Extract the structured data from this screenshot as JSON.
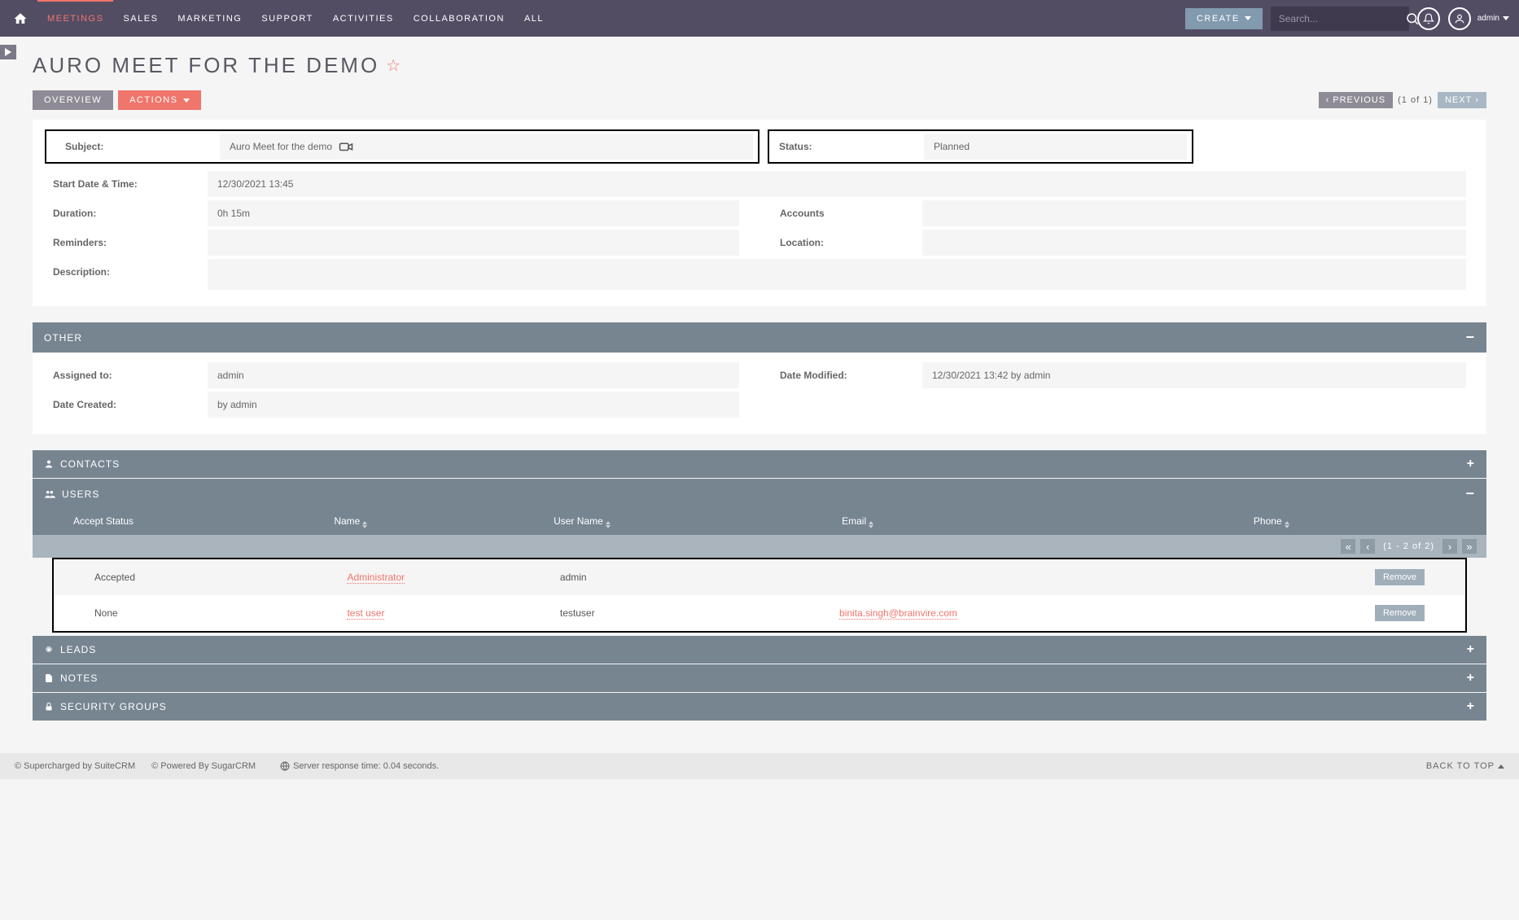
{
  "nav": {
    "items": [
      "MEETINGS",
      "SALES",
      "MARKETING",
      "SUPPORT",
      "ACTIVITIES",
      "COLLABORATION",
      "ALL"
    ],
    "create_label": "CREATE",
    "search_placeholder": "Search...",
    "admin_label": "admin"
  },
  "page": {
    "title": "AURO MEET FOR THE DEMO",
    "overview_btn": "OVERVIEW",
    "actions_btn": "ACTIONS",
    "prev_btn": "PREVIOUS",
    "count_text": "(1 of 1)",
    "next_btn": "NEXT"
  },
  "details": {
    "subject_label": "Subject:",
    "subject_value": "Auro Meet for the demo",
    "status_label": "Status:",
    "status_value": "Planned",
    "start_label": "Start Date & Time:",
    "start_value": "12/30/2021 13:45",
    "duration_label": "Duration:",
    "duration_value": "0h 15m",
    "accounts_label": "Accounts",
    "reminders_label": "Reminders:",
    "location_label": "Location:",
    "description_label": "Description:"
  },
  "other": {
    "header": "OTHER",
    "assigned_label": "Assigned to:",
    "assigned_value": "admin",
    "modified_label": "Date Modified:",
    "modified_value": "12/30/2021 13:42 by admin",
    "created_label": "Date Created:",
    "created_value": "by admin"
  },
  "panels": {
    "contacts": "CONTACTS",
    "users": "USERS",
    "leads": "LEADS",
    "notes": "NOTES",
    "security": "SECURITY GROUPS"
  },
  "users_table": {
    "headers": [
      "Accept Status",
      "Name",
      "User Name",
      "Email",
      "Phone"
    ],
    "pager_text": "(1 - 2 of 2)",
    "remove_label": "Remove",
    "rows": [
      {
        "accept": "Accepted",
        "name": "Administrator",
        "username": "admin",
        "email": "",
        "phone": ""
      },
      {
        "accept": "None",
        "name": "test user",
        "username": "testuser",
        "email": "binita.singh@brainvire.com",
        "phone": ""
      }
    ]
  },
  "footer": {
    "supercharged": "© Supercharged by SuiteCRM",
    "powered": "© Powered By SugarCRM",
    "response_time": "Server response time: 0.04 seconds.",
    "back_to_top": "BACK TO TOP"
  }
}
